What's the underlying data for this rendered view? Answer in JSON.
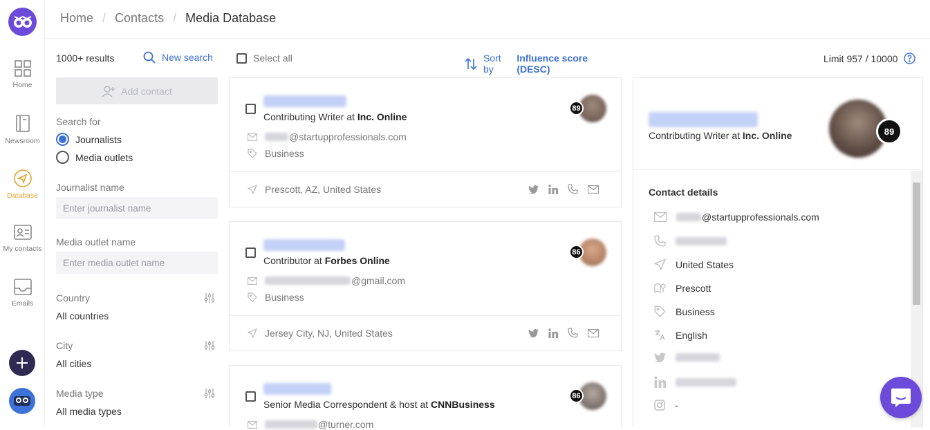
{
  "nav": {
    "items": [
      {
        "label": "Home",
        "icon": "grid-icon"
      },
      {
        "label": "Newsroom",
        "icon": "book-icon"
      },
      {
        "label": "Database",
        "icon": "navigation-icon",
        "active": true
      },
      {
        "label": "My contacts",
        "icon": "contact-card-icon"
      },
      {
        "label": "Emails",
        "icon": "inbox-icon"
      }
    ]
  },
  "breadcrumb": {
    "home": "Home",
    "contacts": "Contacts",
    "current": "Media Database"
  },
  "filters": {
    "results": "1000+ results",
    "new_search": "New search",
    "add_contact": "Add contact",
    "search_for_label": "Search for",
    "search_for_options": [
      "Journalists",
      "Media outlets"
    ],
    "search_for_selected": "Journalists",
    "journalist_name_label": "Journalist name",
    "journalist_name_placeholder": "Enter journalist name",
    "media_outlet_label": "Media outlet name",
    "media_outlet_placeholder": "Enter media outlet name",
    "country_label": "Country",
    "country_value": "All countries",
    "city_label": "City",
    "city_value": "All cities",
    "media_type_label": "Media type",
    "media_type_value": "All media types"
  },
  "list": {
    "select_all": "Select all",
    "sort_prefix": "Sort by",
    "sort_field": "Influence score (DESC)",
    "limit": "Limit 957 / 10000"
  },
  "cards": [
    {
      "role": "Contributing Writer at",
      "outlet": "Inc. Online",
      "email_domain": "@startupprofessionals.com",
      "tag": "Business",
      "location": "Prescott,  AZ,  United States",
      "score": "89",
      "avatar_color": "#a08a7d"
    },
    {
      "role": "Contributor at",
      "outlet": "Forbes Online",
      "email_domain": "@gmail.com",
      "tag": "Business",
      "location": "Jersey City,  NJ,  United States",
      "score": "86",
      "avatar_color": "#c9967a"
    },
    {
      "role": "Senior Media Correspondent & host at",
      "outlet": "CNNBusiness",
      "email_domain": "@turner.com",
      "score": "86",
      "avatar_color": "#8a7f78"
    }
  ],
  "detail": {
    "role": "Contributing Writer at",
    "outlet": "Inc. Online",
    "score": "89",
    "section_title": "Contact details",
    "email_domain": "@startupprofessionals.com",
    "country": "United States",
    "city": "Prescott",
    "category": "Business",
    "language": "English",
    "instagram": "-"
  },
  "colors": {
    "accent": "#3c6fd8",
    "brand": "#6c4bdb",
    "active_nav": "#e0a32e"
  }
}
